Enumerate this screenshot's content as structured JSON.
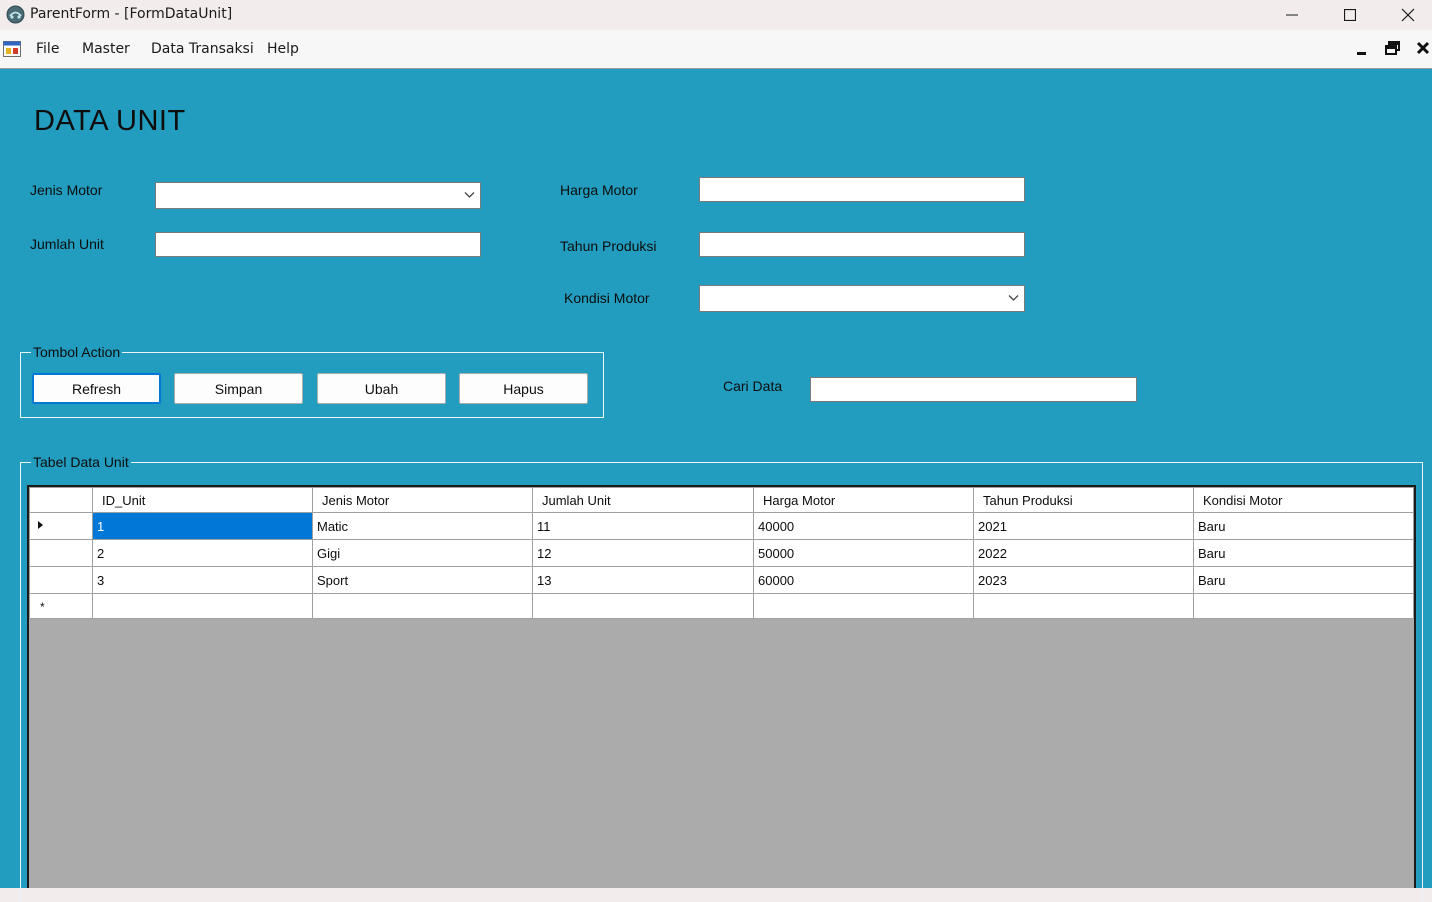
{
  "window": {
    "title": "ParentForm - [FormDataUnit]"
  },
  "menu": {
    "items": [
      "File",
      "Master",
      "Data Transaksi",
      "Help"
    ]
  },
  "form": {
    "title": "DATA UNIT",
    "labels": {
      "jenis_motor": "Jenis Motor",
      "jumlah_unit": "Jumlah Unit",
      "harga_motor": "Harga Motor",
      "tahun_produksi": "Tahun Produksi",
      "kondisi_motor": "Kondisi Motor",
      "cari_data": "Cari Data"
    },
    "values": {
      "jenis_motor": "",
      "jumlah_unit": "",
      "harga_motor": "",
      "tahun_produksi": "",
      "kondisi_motor": "",
      "cari_data": ""
    }
  },
  "action_group": {
    "title": "Tombol Action",
    "buttons": {
      "refresh": "Refresh",
      "simpan": "Simpan",
      "ubah": "Ubah",
      "hapus": "Hapus"
    }
  },
  "table_group": {
    "title": "Tabel Data Unit",
    "columns": [
      "ID_Unit",
      "Jenis Motor",
      "Jumlah Unit",
      "Harga Motor",
      "Tahun Produksi",
      "Kondisi Motor"
    ],
    "rows": [
      [
        "1",
        "Matic",
        "11",
        "40000",
        "2021",
        "Baru"
      ],
      [
        "2",
        "Gigi",
        "12",
        "50000",
        "2022",
        "Baru"
      ],
      [
        "3",
        "Sport",
        "13",
        "60000",
        "2023",
        "Baru"
      ]
    ],
    "current_row_marker": "▸",
    "new_row_marker": "*"
  },
  "icons": {
    "app": "app-icon",
    "mdi_child": "mdi-child-icon",
    "minimize": "minimize-icon",
    "maximize": "maximize-icon",
    "close": "close-icon"
  },
  "colors": {
    "client_bg": "#229dbf",
    "selection": "#0078d7",
    "grid_empty": "#ababab"
  }
}
